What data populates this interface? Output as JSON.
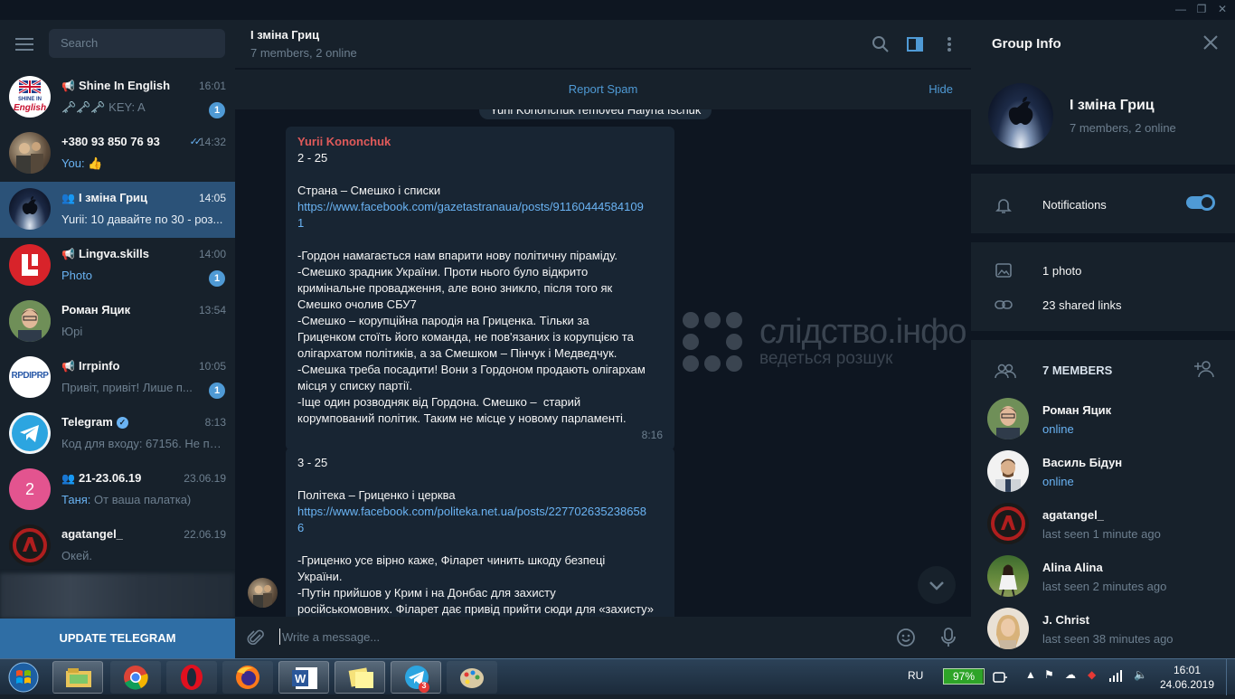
{
  "left": {
    "search_placeholder": "Search",
    "chats": [
      {
        "name": "Shine In English",
        "time": "16:01",
        "preview": "🗝️🗝️🗝️ KEY: A",
        "badge": "1",
        "kind": "channel"
      },
      {
        "name": "+380 93 850 76 93",
        "time": "14:32",
        "preview_sender": "You:",
        "preview": " 👍",
        "kind": "user"
      },
      {
        "name": "І зміна Гриц",
        "time": "14:05",
        "preview": "Yurii: 10 давайте по 30 - роз...",
        "kind": "group",
        "active": true
      },
      {
        "name": "Lingva.skills",
        "time": "14:00",
        "preview_sender": "Photo",
        "preview": "",
        "badge": "1",
        "kind": "channel"
      },
      {
        "name": "Роман Яцик",
        "time": "13:54",
        "preview": "Юрі",
        "kind": "user"
      },
      {
        "name": "Irrpinfo",
        "time": "10:05",
        "preview": "Привіт, привіт!  Лише п...",
        "badge": "1",
        "kind": "channel"
      },
      {
        "name": "Telegram",
        "time": "8:13",
        "preview": "Код для входу: 67156. Не по...",
        "kind": "verified"
      },
      {
        "name": "21-23.06.19",
        "time": "23.06.19",
        "preview_sender": "Таня:",
        "preview": " От ваша палатка)",
        "kind": "group",
        "avatar_letter": "2"
      },
      {
        "name": "agatangel_",
        "time": "22.06.19",
        "preview": "Окей.",
        "kind": "user"
      }
    ],
    "update_button": "UPDATE TELEGRAM",
    "avatar_labels": {
      "shine_top": "SHINE IN",
      "shine_bottom": "English",
      "irrp": "RPDIPRP"
    }
  },
  "chat": {
    "title": "І зміна Гриц",
    "subtitle": "7 members, 2 online",
    "report_spam": "Report Spam",
    "hide": "Hide",
    "service_message": "Yurii Kononchuk removed Halyna Ischuk",
    "messages": [
      {
        "sender": "Yurii Kononchuk",
        "lines": [
          {
            "t": "2 - 25"
          },
          {
            "t": ""
          },
          {
            "t": "Страна – Смешко і списки"
          },
          {
            "t": "https://www.facebook.com/gazetastranaua/posts/91160444584109",
            "link": true
          },
          {
            "t": "1",
            "link": true
          },
          {
            "t": ""
          },
          {
            "t": "-Гордон намагається нам впарити нову політичну піраміду."
          },
          {
            "t": "-Смешко зрадник України. Проти нього було відкрито"
          },
          {
            "t": "кримінальне провадження, але воно зникло, після того як"
          },
          {
            "t": "Смешко очолив СБУ7"
          },
          {
            "t": "-Смешко – корупційна пародія на Гриценка. Тільки за"
          },
          {
            "t": "Гриценком стоїть його команда, не пов'язаних із корупцією та"
          },
          {
            "t": "олігархатом політиків, а за Смешком – Пінчук і Медведчук."
          },
          {
            "t": "-Смешка треба посадити! Вони з Гордоном продають олігархам"
          },
          {
            "t": "місця у списку партії."
          },
          {
            "t": "-Іще один розводняк від Гордона. Смешко –  старий"
          },
          {
            "t": "корумпований політик. Таким не місце у новому парламенті."
          }
        ],
        "time": "8:16"
      },
      {
        "sender": "",
        "lines": [
          {
            "t": "3 - 25"
          },
          {
            "t": ""
          },
          {
            "t": "Політека – Гриценко і церква"
          },
          {
            "t": "https://www.facebook.com/politeka.net.ua/posts/227702635238658",
            "link": true
          },
          {
            "t": "6",
            "link": true
          },
          {
            "t": ""
          },
          {
            "t": "-Гриценко усе вірно каже, Філарет чинить шкоду безпеці"
          },
          {
            "t": "України."
          },
          {
            "t": "-Путін прийшов у Крим і на Донбас для захисту"
          },
          {
            "t": "російськомовних. Філарет дає привід прийти сюди для «захисту»"
          }
        ],
        "time": ""
      }
    ],
    "watermark_top": "слідство.інфо",
    "watermark_bottom": "ведеться розшук",
    "input_placeholder": "Write a message..."
  },
  "info": {
    "title": "Group Info",
    "group_name": "І зміна Гриц",
    "group_sub": "7 members, 2 online",
    "notifications": "Notifications",
    "notifications_on": true,
    "photos": "1 photo",
    "links": "23 shared links",
    "members_label": "7 MEMBERS",
    "members": [
      {
        "name": "Роман Яцик",
        "status": "online",
        "online": true
      },
      {
        "name": "Василь Бідун",
        "status": "online",
        "online": true
      },
      {
        "name": "agatangel_",
        "status": "last seen 1 minute ago",
        "online": false
      },
      {
        "name": "Alina Alina",
        "status": "last seen 2 minutes ago",
        "online": false
      },
      {
        "name": "J. Christ",
        "status": "last seen 38 minutes ago",
        "online": false
      }
    ]
  },
  "taskbar": {
    "language": "RU",
    "battery": "97%",
    "battery_level": 0.97,
    "time": "16:01",
    "date": "24.06.2019",
    "telegram_badge": "3"
  },
  "colors": {
    "accent": "#4f9ad5",
    "link": "#6ab3f3",
    "sender": "#e05a5a",
    "active_chat": "#2b5278"
  }
}
